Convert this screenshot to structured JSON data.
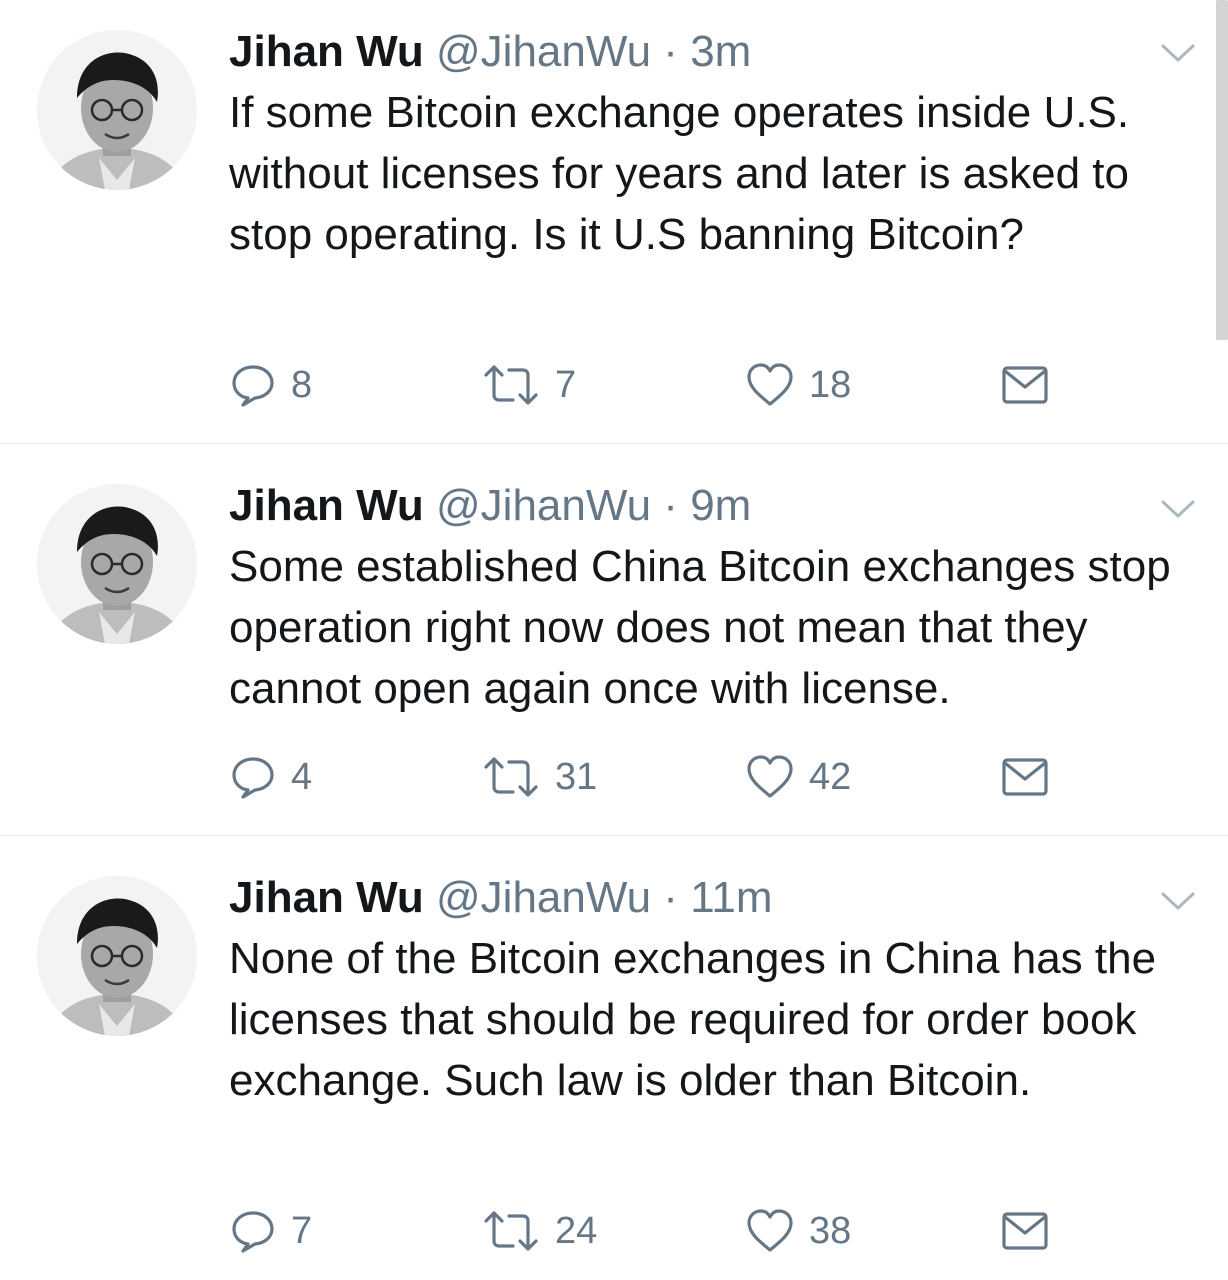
{
  "tweets": [
    {
      "author_name": "Jihan Wu",
      "handle": "@JihanWu",
      "separator": "·",
      "time": "3m",
      "text": "If some Bitcoin exchange operates inside U.S. without licenses for years and later is asked to stop operating. Is it U.S banning Bitcoin?",
      "reply_count": "8",
      "retweet_count": "7",
      "like_count": "18"
    },
    {
      "author_name": "Jihan Wu",
      "handle": "@JihanWu",
      "separator": "·",
      "time": "9m",
      "text": "Some established China Bitcoin exchanges stop operation right now does not mean that they cannot open again once with license.",
      "reply_count": "4",
      "retweet_count": "31",
      "like_count": "42"
    },
    {
      "author_name": "Jihan Wu",
      "handle": "@JihanWu",
      "separator": "·",
      "time": "11m",
      "text": "None of the Bitcoin exchanges in China has the licenses that should be required for order book exchange. Such law is older than Bitcoin.",
      "reply_count": "7",
      "retweet_count": "24",
      "like_count": "38"
    }
  ],
  "icons": {
    "menu": "chevron-down-icon",
    "reply": "reply-bubble-icon",
    "retweet": "retweet-icon",
    "like": "heart-icon",
    "message": "envelope-icon"
  },
  "colors": {
    "text": "#14171a",
    "secondary": "#657786",
    "divider": "#e1e8ed"
  }
}
